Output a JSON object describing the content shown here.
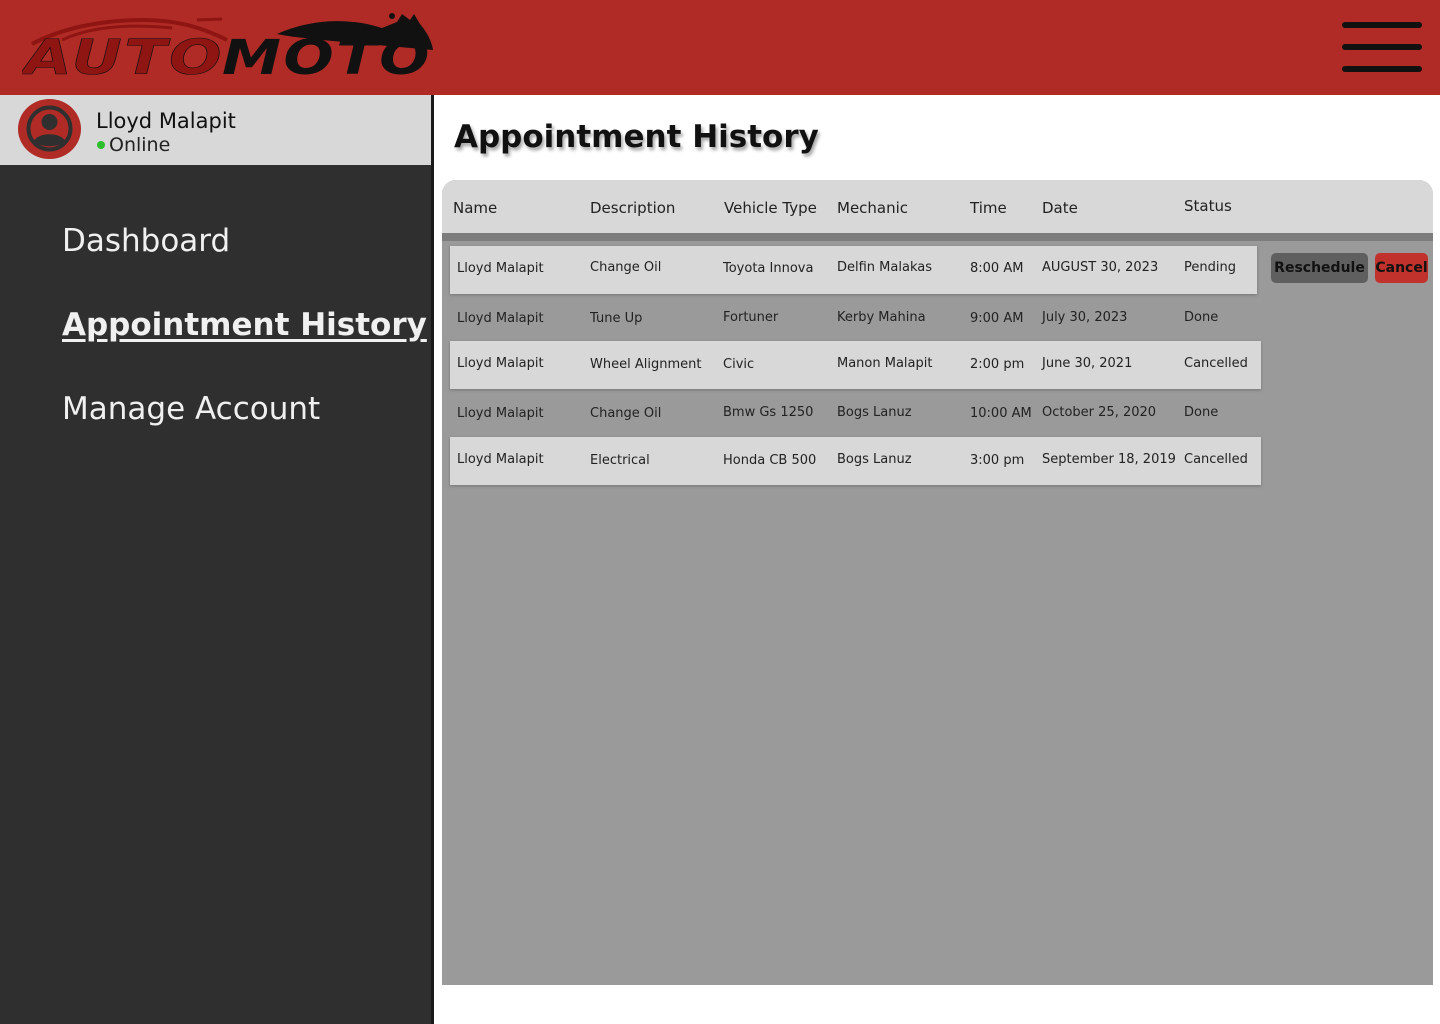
{
  "brand": {
    "logo_text_part1": "AUTO",
    "logo_text_part2": "MOTO",
    "primary_color": "#b02b26"
  },
  "header": {
    "menu_icon": "hamburger-menu-icon"
  },
  "user": {
    "name": "Lloyd Malapit",
    "status": "Online",
    "status_color": "#2dbe2d",
    "avatar_icon": "user-avatar-icon"
  },
  "nav": {
    "items": [
      {
        "label": "Dashboard",
        "active": false
      },
      {
        "label": "Appointment History",
        "active": true
      },
      {
        "label": "Manage Account",
        "active": false
      }
    ]
  },
  "page": {
    "title": "Appointment History"
  },
  "table": {
    "columns": [
      "Name",
      "Description",
      "Vehicle Type",
      "Mechanic",
      "Time",
      "Date",
      "Status"
    ],
    "rows": [
      [
        "Lloyd Malapit",
        "Change Oil",
        "Toyota Innova",
        "Delfin Malakas",
        "8:00 AM",
        "AUGUST 30, 2023",
        "Pending"
      ],
      [
        "Lloyd Malapit",
        "Tune Up",
        "Fortuner",
        "Kerby Mahina",
        "9:00 AM",
        "July 30, 2023",
        "Done"
      ],
      [
        "Lloyd Malapit",
        "Wheel Alignment",
        "Civic",
        "Manon Malapit",
        "2:00 pm",
        "June 30, 2021",
        "Cancelled"
      ],
      [
        "Lloyd Malapit",
        "Change Oil",
        "Bmw Gs 1250",
        "Bogs Lanuz",
        "10:00 AM",
        "October  25, 2020",
        "Done"
      ],
      [
        "Lloyd Malapit",
        "Electrical",
        "Honda CB 500",
        "Bogs Lanuz",
        "3:00 pm",
        "September 18, 2019",
        "Cancelled"
      ]
    ],
    "actions": {
      "reschedule_label": "Reschedule",
      "cancel_label": "Cancel"
    }
  }
}
